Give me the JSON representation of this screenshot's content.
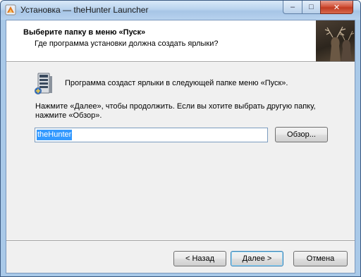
{
  "window": {
    "title": "Установка — theHunter Launcher",
    "controls": {
      "minimize": "–",
      "maximize": "□",
      "close": "✕"
    }
  },
  "header": {
    "title": "Выберите папку в меню «Пуск»",
    "subtitle": "Где программа установки должна создать ярлыки?"
  },
  "body": {
    "info": "Программа создаст ярлыки в следующей папке меню «Пуск».",
    "instructions": "Нажмите «Далее», чтобы продолжить. Если вы хотите выбрать другую папку, нажмите «Обзор»."
  },
  "folder_input": {
    "value": "theHunter"
  },
  "buttons": {
    "browse": "Обзор...",
    "back": "< Назад",
    "next": "Далее >",
    "cancel": "Отмена"
  },
  "colors": {
    "selection": "#3399ff",
    "close_button": "#c13a22",
    "title_bar": "#b9d3ee"
  }
}
